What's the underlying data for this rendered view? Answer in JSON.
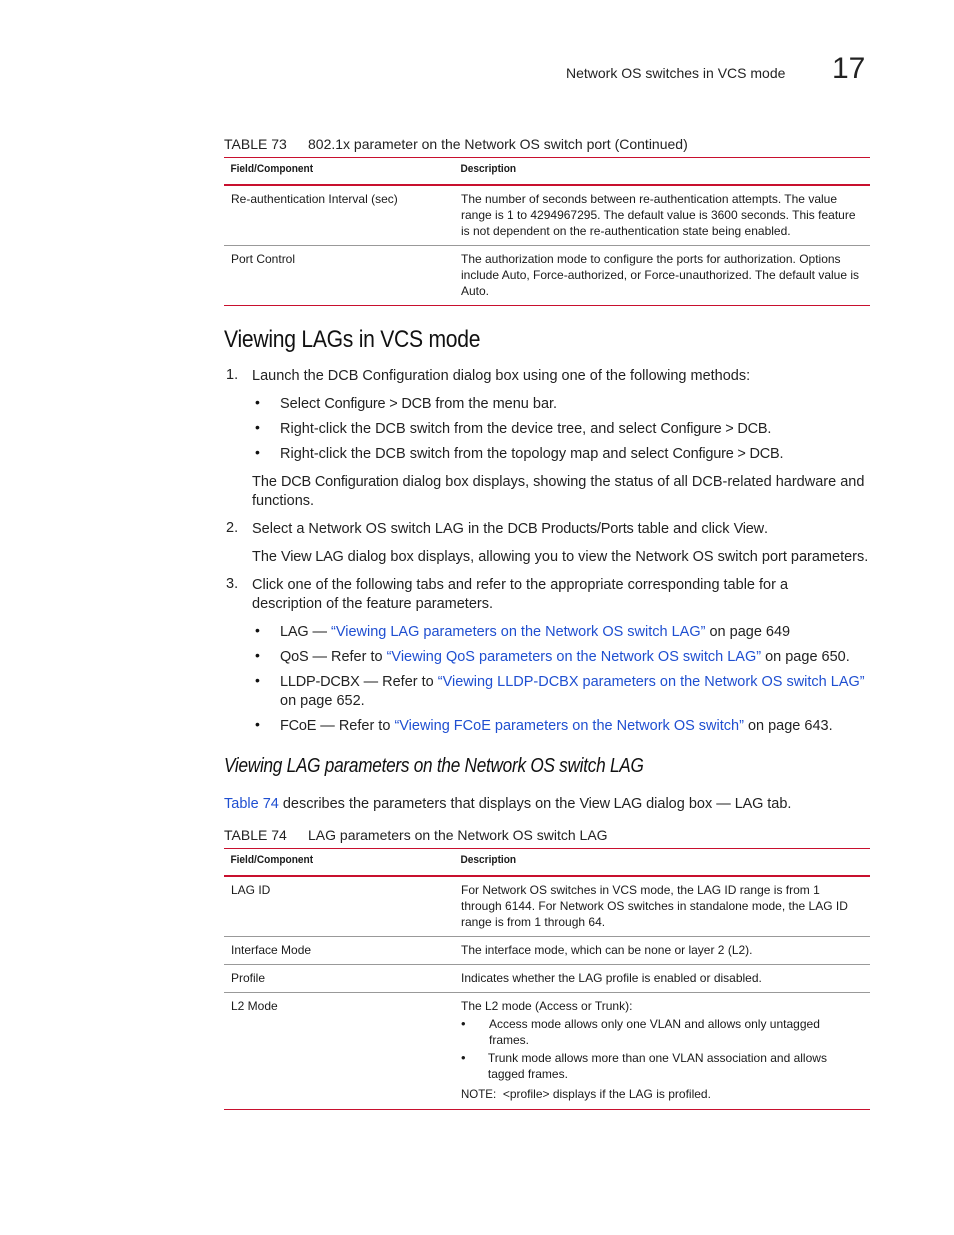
{
  "header": {
    "section_title": "Network OS switches in VCS mode",
    "chapter_number": "17"
  },
  "table73": {
    "label": "TABLE 73",
    "caption": "802.1x parameter on the Network OS switch port (Continued)",
    "headers": [
      "Field/Component",
      "Description"
    ],
    "rows": [
      {
        "field": "Re-authentication Interval (sec)",
        "description": "The number of seconds between re-authentication attempts. The value range is 1 to 4294967295. The default value is 3600 seconds. This feature is not dependent on the re-authentication state being enabled."
      },
      {
        "field": "Port Control",
        "description": "The authorization mode to configure the ports for authorization. Options include Auto, Force-authorized, or Force-unauthorized. The default value is Auto."
      }
    ]
  },
  "section1": {
    "heading": "Viewing LAGs in VCS mode",
    "step1": {
      "num": "1.",
      "text": "Launch the DCB Configuration dialog box using one of the following methods:",
      "bullets": [
        {
          "pre": "Select ",
          "ui": "Configure > DCB",
          "post": " from the menu bar."
        },
        {
          "pre": "Right-click the DCB switch from the device tree, and select ",
          "ui": "Configure > DCB",
          "post": "."
        },
        {
          "pre": "Right-click the DCB switch from the topology map and select ",
          "ui": "Configure > DCB",
          "post": "."
        }
      ],
      "result_pre": "The ",
      "result_ui": "DCB Configuration",
      "result_post": " dialog box displays, showing the status of all DCB-related hardware and functions."
    },
    "step2": {
      "num": "2.",
      "pre": "Select a Network OS switch LAG in the ",
      "ui1": "DCB Products/Ports",
      "mid": " table and click ",
      "ui2": "View",
      "post": ".",
      "result_pre": "The ",
      "result_ui": "View LAG",
      "result_post": " dialog box displays, allowing you to view the Network OS switch port parameters."
    },
    "step3": {
      "num": "3.",
      "text": "Click one of the following tabs and refer to the appropriate corresponding table for a description of the feature parameters.",
      "bullets": [
        {
          "ui": "LAG",
          "pre": " — ",
          "link": "“Viewing LAG parameters on the Network OS switch LAG”",
          "post": " on page 649"
        },
        {
          "ui": "QoS",
          "pre": " — Refer to ",
          "link": "“Viewing QoS parameters on the Network OS switch LAG”",
          "post": " on page 650."
        },
        {
          "ui": "LLDP-DCBX",
          "pre": " — Refer to ",
          "link": "“Viewing LLDP-DCBX parameters on the Network OS switch LAG”",
          "post": " on page 652."
        },
        {
          "ui": "FCoE",
          "pre": " — Refer to ",
          "link": "“Viewing FCoE parameters on the Network OS switch”",
          "post": " on page 643."
        }
      ]
    }
  },
  "section2": {
    "heading": "Viewing LAG parameters on the Network OS switch LAG",
    "intro_link": "Table 74",
    "intro_pre": " describes the parameters that displays on the ",
    "intro_ui1": "View LAG",
    "intro_mid": " dialog box — ",
    "intro_ui2": "LAG",
    "intro_post": " tab."
  },
  "table74": {
    "label": "TABLE 74",
    "caption": "LAG parameters on the Network OS switch LAG",
    "headers": [
      "Field/Component",
      "Description"
    ],
    "rows": [
      {
        "field": "LAG ID",
        "description": "For Network OS switches in VCS mode, the LAG ID range is from 1 through 6144. For Network OS switches in standalone mode, the LAG ID range is from 1 through 64."
      },
      {
        "field": "Interface Mode",
        "description": "The interface mode, which can be none or layer 2 (L2)."
      },
      {
        "field": "Profile",
        "description": "Indicates whether the LAG profile is enabled or disabled."
      },
      {
        "field": "L2 Mode",
        "description": "The L2 mode (Access or Trunk):",
        "bullets": [
          "Access mode allows only one VLAN and allows only untagged frames.",
          "Trunk mode allows more than one VLAN association and allows tagged frames."
        ],
        "note_label": "NOTE:",
        "note_text": "<profile> displays if the LAG is profiled."
      }
    ]
  }
}
